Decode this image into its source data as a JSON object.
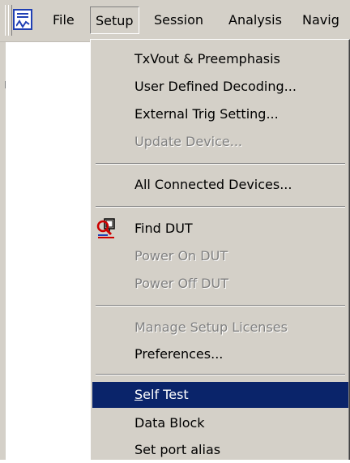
{
  "menubar": {
    "items": [
      {
        "label": "File"
      },
      {
        "label": "Setup"
      },
      {
        "label": "Session"
      },
      {
        "label": "Analysis"
      },
      {
        "label": "Navig"
      }
    ],
    "active_index": 1
  },
  "setup_menu": {
    "items": [
      {
        "label": "TxVout & Preemphasis",
        "enabled": true
      },
      {
        "label": "User Defined Decoding...",
        "enabled": true
      },
      {
        "label": "External Trig Setting...",
        "enabled": true
      },
      {
        "label": "Update Device...",
        "enabled": false
      },
      {
        "label": "All Connected Devices...",
        "enabled": true
      },
      {
        "label": "Find DUT",
        "enabled": true,
        "icon": "find-dut-icon"
      },
      {
        "label": "Power On DUT",
        "enabled": false
      },
      {
        "label": "Power Off DUT",
        "enabled": false
      },
      {
        "label": "Manage Setup Licenses",
        "enabled": false
      },
      {
        "label": "Preferences...",
        "enabled": true
      },
      {
        "label_mnemonic": "S",
        "label_rest": "elf Test",
        "enabled": true,
        "highlighted": true
      },
      {
        "label": "Data Block",
        "enabled": true
      },
      {
        "label": "Set port alias",
        "enabled": true
      }
    ]
  },
  "colors": {
    "menu_background": "#d4d0c8",
    "highlight": "#0a246a",
    "disabled_text": "#808080",
    "app_icon_blue": "#1f3fb4"
  }
}
